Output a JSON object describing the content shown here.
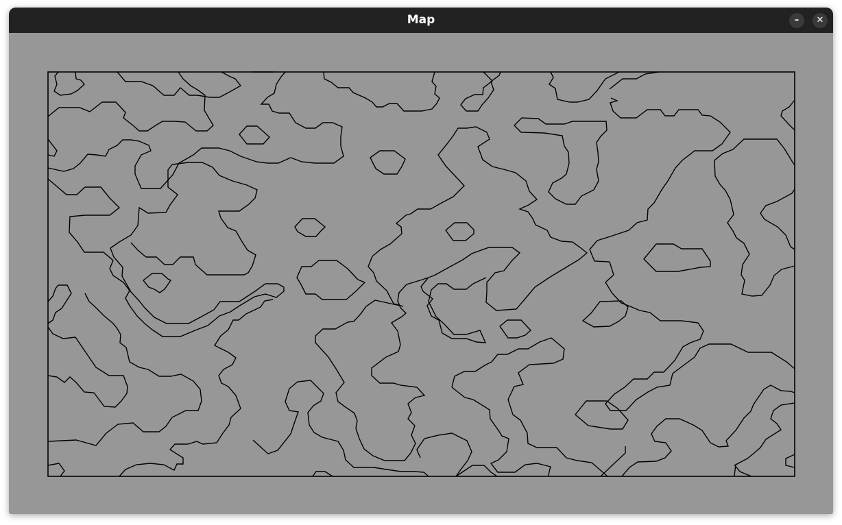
{
  "window": {
    "title": "Map",
    "minimize_glyph": "–",
    "close_glyph": "✕"
  },
  "map": {
    "background_color": "#979797",
    "line_color": "#000000",
    "frame_color": "#000000"
  }
}
